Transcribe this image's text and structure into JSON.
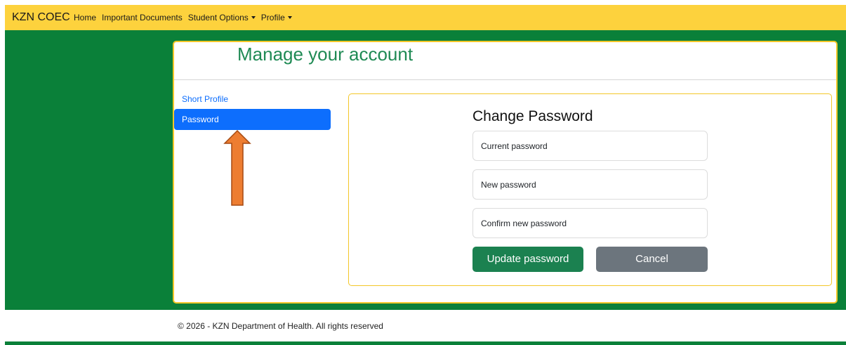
{
  "navbar": {
    "brand": "KZN COEC",
    "items": [
      {
        "label": "Home"
      },
      {
        "label": "Important Documents"
      },
      {
        "label": "Student Options"
      },
      {
        "label": "Profile"
      }
    ]
  },
  "page": {
    "title": "Manage your account"
  },
  "sidebar": {
    "items": [
      {
        "label": "Short Profile"
      },
      {
        "label": "Password"
      }
    ]
  },
  "form": {
    "title": "Change Password",
    "current_password_label": "Current password",
    "new_password_label": "New password",
    "confirm_password_label": "Confirm new password",
    "update_button": "Update password",
    "cancel_button": "Cancel"
  },
  "footer": {
    "text": "© 2026 - KZN Department of Health. All rights reserved"
  },
  "colors": {
    "navbar": "#fdd23d",
    "band": "#0a8039",
    "title": "#1f8a54",
    "active_item": "#0d6efd",
    "primary_button": "#1b8150",
    "secondary_button": "#6c757d",
    "card_border": "#f3c728",
    "arrow": "#ed7d31"
  },
  "icons": [
    "caret-down-icon",
    "up-arrow-annotation"
  ]
}
